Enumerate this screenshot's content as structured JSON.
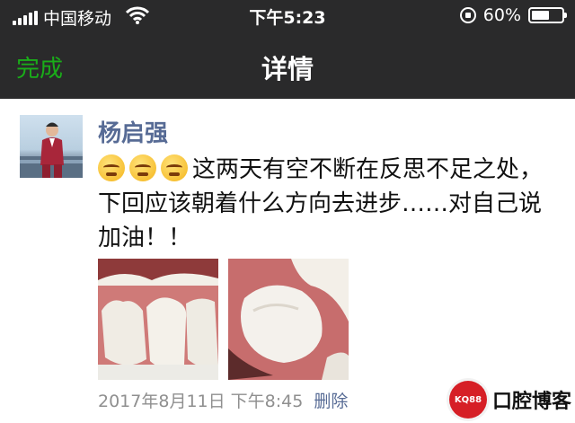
{
  "status_bar": {
    "carrier": "中国移动",
    "time": "下午5:23",
    "battery_percent": "60%",
    "battery_level": 0.6,
    "icons": [
      "signal-bars-icon",
      "wifi-icon",
      "rotation-lock-icon",
      "battery-icon"
    ]
  },
  "nav": {
    "done_label": "完成",
    "title": "详情"
  },
  "post": {
    "username": "杨启强",
    "emojis": [
      "frowning-face-emoji",
      "frowning-face-emoji",
      "frowning-face-emoji"
    ],
    "text": "这两天有空不断在反思不足之处，下回应该朝着什么方向去进步……对自己说加油！！",
    "photos": [
      "teeth-photo-1",
      "teeth-photo-2"
    ],
    "timestamp": "2017年8月11日 下午8:45",
    "delete_label": "删除"
  },
  "watermark": {
    "logo_text": "KQ88",
    "text": "口腔博客"
  },
  "colors": {
    "header_bg": "#2a2a2b",
    "accent_green": "#1aad19",
    "link_blue": "#576b95",
    "meta_gray": "#8f8f8f"
  }
}
